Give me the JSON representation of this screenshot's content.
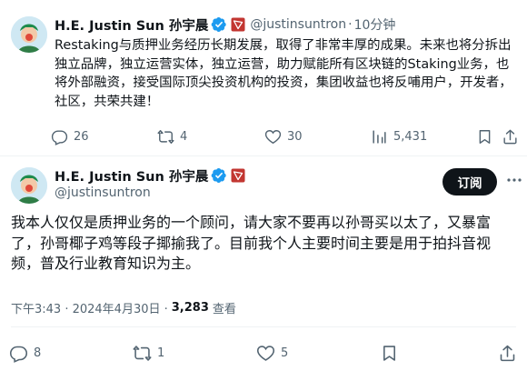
{
  "tweet1": {
    "author_name": "H.E. Justin Sun 孙宇晨",
    "handle": "@justinsuntron",
    "separator": "·",
    "time": "10分钟",
    "text": "Restaking与质押业务经历长期发展，取得了非常丰厚的成果。未来也将分拆出独立品牌，独立运营实体，独立运营，助力赋能所有区块链的Staking业务，也将外部融资，接受国际顶尖投资机构的投资，集团收益也将反哺用户，开发者，社区，共荣共建！",
    "replies": "26",
    "reposts": "4",
    "likes": "30",
    "views": "5,431"
  },
  "tweet2": {
    "author_name": "H.E. Justin Sun 孙宇晨",
    "handle": "@justinsuntron",
    "subscribe_label": "订阅",
    "text": "我本人仅仅是质押业务的一个顾问，请大家不要再以孙哥买以太了，又暴富了，孙哥椰子鸡等段子揶揄我了。目前我个人主要时间主要是用于拍抖音视频，普及行业教育知识为主。",
    "timestamp": "下午3:43 · 2024年4月30日 ·",
    "views_count": "3,283",
    "views_label": "查看",
    "replies": "8",
    "reposts": "1",
    "likes": "5"
  },
  "colors": {
    "text": "#0f1419",
    "secondary": "#536471",
    "verified": "#1d9bf0",
    "brand_badge": "#c23631",
    "button_bg": "#0f1419"
  }
}
